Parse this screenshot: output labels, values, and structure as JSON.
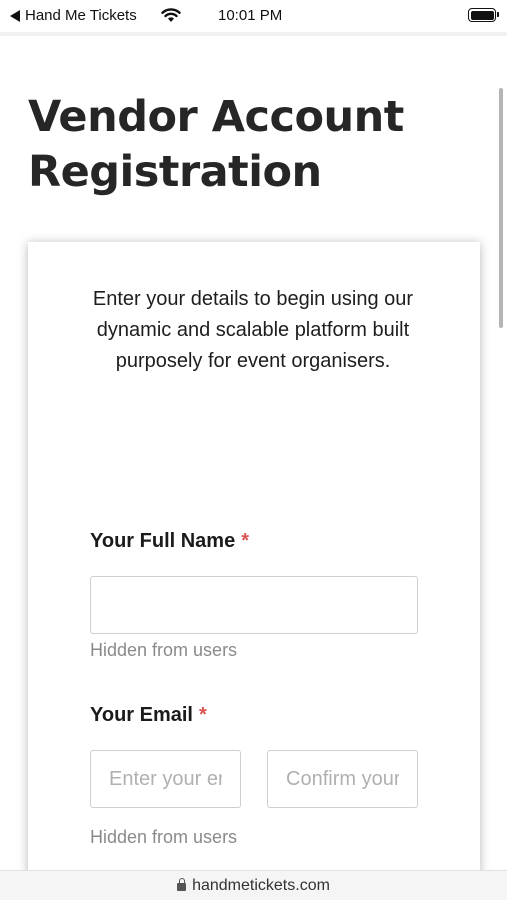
{
  "status_bar": {
    "back_app": "Hand Me Tickets",
    "time": "10:01 PM"
  },
  "page": {
    "title": "Vendor Account Registration"
  },
  "form": {
    "intro": "Enter your details to begin using our dynamic and scalable platform built purposely for event organisers.",
    "full_name": {
      "label": "Your Full Name",
      "required_mark": "*",
      "value": "",
      "help": "Hidden from users"
    },
    "email": {
      "label": "Your Email",
      "required_mark": "*",
      "placeholder": "Enter your email",
      "confirm_placeholder": "Confirm your email",
      "help": "Hidden from users"
    }
  },
  "browser": {
    "url": "handmetickets.com"
  }
}
